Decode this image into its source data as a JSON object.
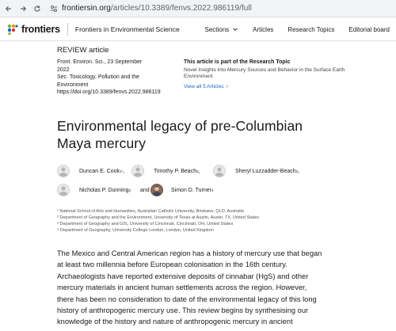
{
  "browser": {
    "url_host": "frontiersin.org",
    "url_path": "/articles/10.3389/fenvs.2022.986119/full"
  },
  "header": {
    "logo_text": "frontiers",
    "journal_name": "Frontiers in Environmental Science",
    "nav": {
      "sections": "Sections",
      "articles": "Articles",
      "research_topics": "Research Topics",
      "editorial_board": "Editorial board"
    }
  },
  "article": {
    "type": "REVIEW article",
    "meta": {
      "citation": "Front. Environ. Sci., 23 September",
      "year": "2022",
      "section_line1": "Sec. Toxicology, Pollution and the",
      "section_line2": "Environment",
      "doi": "https://doi.org/10.3389/fenvs.2022.986119"
    },
    "research_topic": {
      "heading": "This article is part of the Research Topic",
      "name": "Novel Insights into Mercury Sources and Behavior in the Surface Earth Environment",
      "link": "View all 5 Articles"
    },
    "title_line1": "Environmental legacy of pre-Columbian",
    "title_line2": "Maya mercury",
    "authors": [
      {
        "name": "Duncan E. Cook",
        "sup": "1*",
        "sep": ","
      },
      {
        "name": "Timothy P. Beach",
        "sup": "2",
        "sep": ","
      },
      {
        "name": "Sheryl Luzzadder-Beach",
        "sup": "2",
        "sep": ","
      },
      {
        "name": "Nicholas P. Dunning",
        "sup": "3",
        "sep": ""
      },
      {
        "name": "Simon D. Turner",
        "sup": "4",
        "sep": ""
      }
    ],
    "and_word": "and",
    "affiliations": [
      "¹ National School of Arts and Humanities, Australian Catholic University, Brisbane, QLD, Australia",
      "² Department of Geography and the Environment, University of Texas at Austin, Austin, TX, United States",
      "³ Department of Geography and GIS, University of Cincinnati, Cincinnati, OH, United States",
      "⁴ Department of Geography, University College London, London, United Kingdom"
    ],
    "abstract_lines": [
      "The Mexico and Central American region has a history of mercury use that began",
      "at least two millennia before European colonisation in the 16th century.",
      "Archaeologists have reported extensive deposits of cinnabar (HgS) and other",
      "mercury materials in ancient human settlements across the region. However,",
      "there has been no consideration to date of the environmental legacy of this long",
      "history of anthropogenic mercury use. This review begins by synthesising our",
      "knowledge of the history and nature of anthropogenic mercury in ancient"
    ]
  },
  "colors": {
    "link": "#1a68c4",
    "logo_green": "#76b82a",
    "logo_orange": "#f7931e",
    "logo_blue": "#1a68c4"
  }
}
